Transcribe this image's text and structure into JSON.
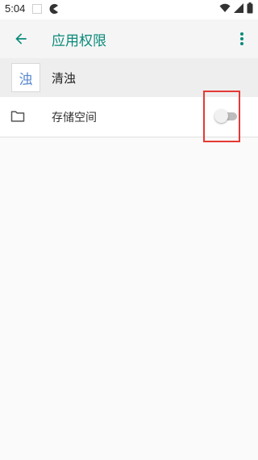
{
  "status_bar": {
    "time": "5:04",
    "icons": [
      "notification-square-icon",
      "pacman-icon",
      "wifi-icon",
      "cellular-signal-icon",
      "battery-icon"
    ]
  },
  "app_bar": {
    "title": "应用权限",
    "back_icon": "arrow-back-icon",
    "more_icon": "more-vert-icon",
    "accent_color": "#0a8a7a"
  },
  "app_header": {
    "icon_text": "浊",
    "name": "清浊"
  },
  "permissions": [
    {
      "icon": "folder-icon",
      "label": "存储空间",
      "enabled": false
    }
  ],
  "highlight_color": "#e53935"
}
